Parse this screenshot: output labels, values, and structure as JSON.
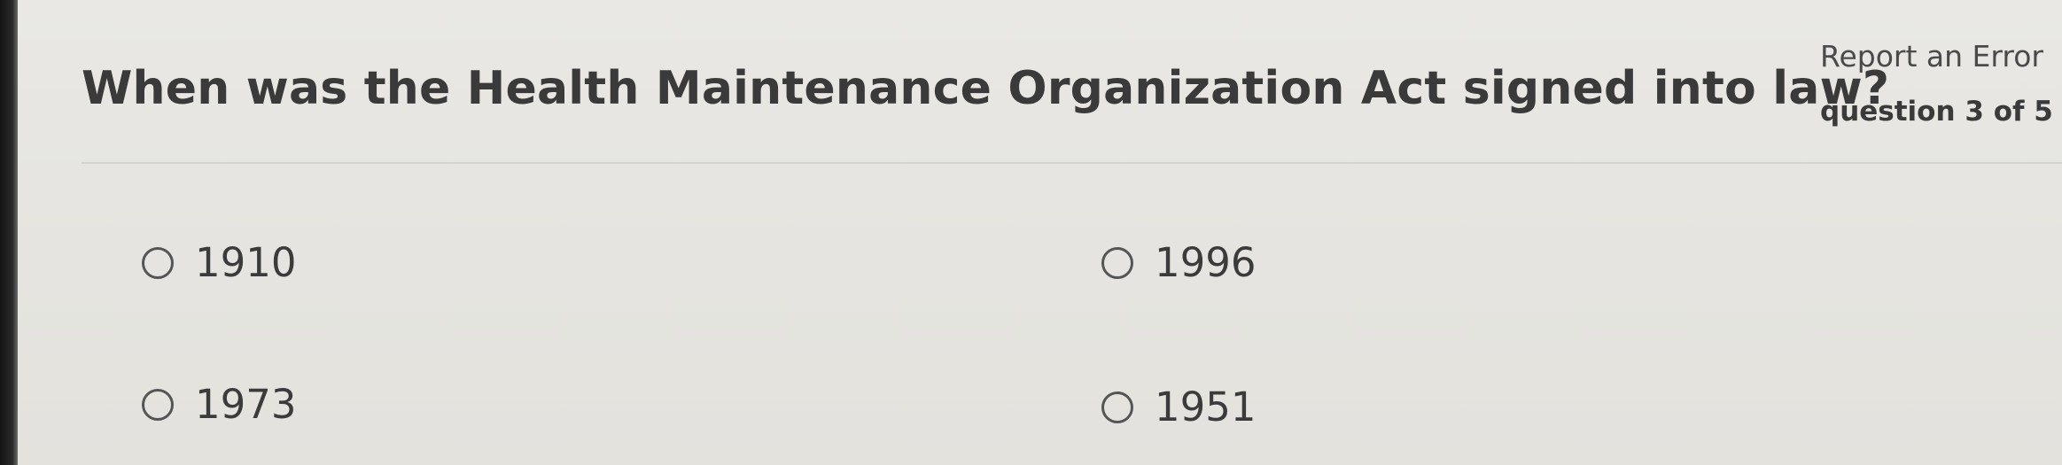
{
  "question": {
    "text": "When was the Health Maintenance Organization Act signed into law?"
  },
  "meta": {
    "report_label": "Report an Error",
    "progress_label": "question 3 of 5"
  },
  "options": [
    {
      "label": "1910"
    },
    {
      "label": "1996"
    },
    {
      "label": "1973"
    },
    {
      "label": "1951"
    }
  ],
  "colors": {
    "background": "#e6e5e1",
    "text": "#3b3b3b",
    "radio_border": "#555555",
    "divider": "#d5d4d0"
  }
}
